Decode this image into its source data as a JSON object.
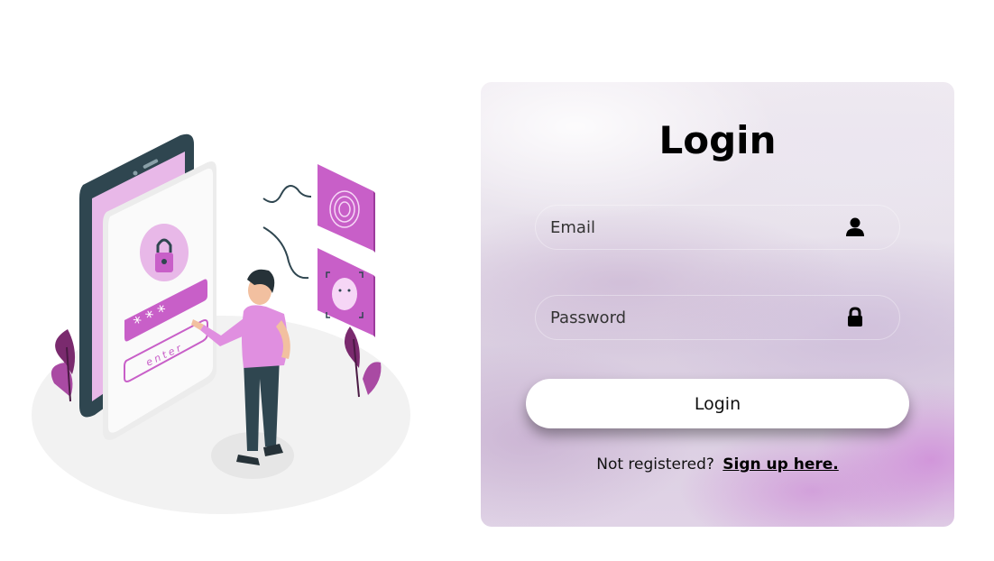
{
  "login_card": {
    "title": "Login",
    "email_placeholder": "Email",
    "password_placeholder": "Password",
    "login_button_label": "Login",
    "not_registered_text": "Not registered?",
    "signup_link_text": "Sign up here.",
    "email_icon": "user-icon",
    "password_icon": "lock-icon"
  },
  "illustration": {
    "screen_button_label": "enter",
    "masked_password": "* * *",
    "icons": [
      "padlock-icon",
      "fingerprint-icon",
      "face-id-icon"
    ]
  },
  "colors": {
    "accent_purple": "#c85fc8",
    "dark_phone": "#2f4650",
    "button_bg": "#ffffff",
    "text": "#111111"
  }
}
